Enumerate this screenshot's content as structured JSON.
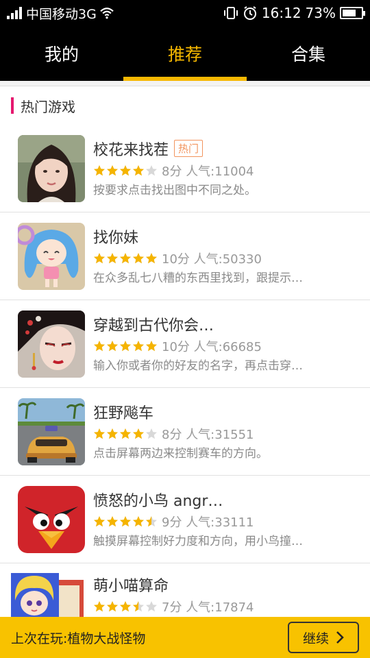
{
  "status_bar": {
    "carrier": "中国移动3G",
    "time": "16:12",
    "battery": "73%",
    "battery_level": 0.73
  },
  "tabs": [
    {
      "label": "我的",
      "active": false
    },
    {
      "label": "推荐",
      "active": true
    },
    {
      "label": "合集",
      "active": false
    }
  ],
  "section": {
    "title": "热门游戏"
  },
  "games": [
    {
      "title": "校花来找茬",
      "badge": "热门",
      "rating": 4,
      "score": "8分",
      "popularity": "人气:11004",
      "desc": "按要求点击找出图中不同之处。",
      "icon": "girl-portrait"
    },
    {
      "title": "找你妹",
      "badge": "",
      "rating": 5,
      "score": "10分",
      "popularity": "人气:50330",
      "desc": "在众多乱七八糟的东西里找到，跟提示…",
      "icon": "cartoon-girl"
    },
    {
      "title": "穿越到古代你会…",
      "badge": "",
      "rating": 5,
      "score": "10分",
      "popularity": "人气:66685",
      "desc": "输入你或者你的好友的名字，再点击穿…",
      "icon": "ancient-lady"
    },
    {
      "title": "狂野飚车",
      "badge": "",
      "rating": 4,
      "score": "8分",
      "popularity": "人气:31551",
      "desc": "点击屏幕两边来控制赛车的方向。",
      "icon": "race-car"
    },
    {
      "title": "愤怒的小鸟 angr…",
      "badge": "",
      "rating": 4.5,
      "score": "9分",
      "popularity": "人气:33111",
      "desc": "触摸屏幕控制好力度和方向，用小鸟撞…",
      "icon": "angry-bird"
    },
    {
      "title": "萌小喵算命",
      "badge": "",
      "rating": 3.5,
      "score": "7分",
      "popularity": "人气:17874",
      "desc": "",
      "icon": "anime-fortune"
    }
  ],
  "footer": {
    "last_played": "上次在玩:植物大战怪物",
    "continue_label": "继续"
  },
  "colors": {
    "accent": "#f6b800",
    "section_marker": "#e5176e",
    "star_on": "#f5b400",
    "star_off": "#d8d8d8"
  }
}
